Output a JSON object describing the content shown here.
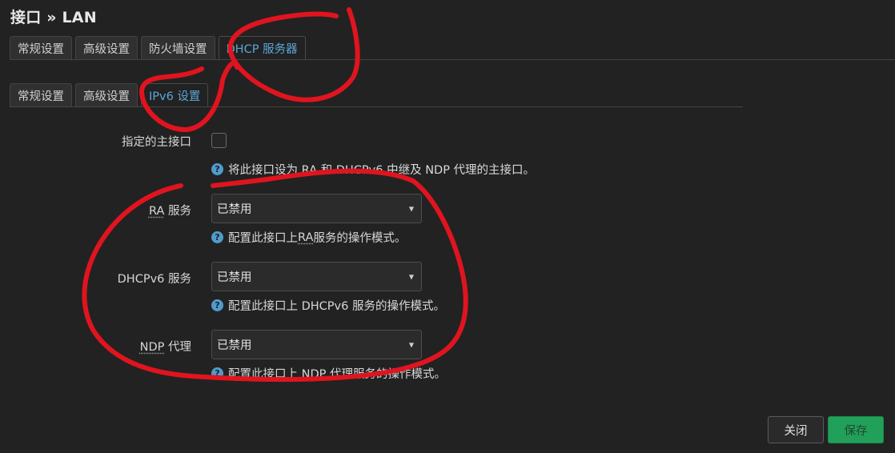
{
  "page": {
    "title": "接口 » LAN"
  },
  "primary_tabs": [
    {
      "label": "常规设置",
      "active": false
    },
    {
      "label": "高级设置",
      "active": false
    },
    {
      "label": "防火墙设置",
      "active": false
    },
    {
      "label": "DHCP 服务器",
      "active": true
    }
  ],
  "secondary_tabs": [
    {
      "label": "常规设置",
      "active": false
    },
    {
      "label": "高级设置",
      "active": false
    },
    {
      "label": "IPv6 设置",
      "active": true
    }
  ],
  "form": {
    "master": {
      "label": "指定的主接口",
      "checked": false,
      "help": "将此接口设为 RA 和 DHCPv6 中继及 NDP 代理的主接口。"
    },
    "ra": {
      "label_abbr": "RA",
      "label_rest": " 服务",
      "value": "已禁用",
      "help_pre": "配置此接口上 ",
      "help_abbr": "RA",
      "help_post": " 服务的操作模式。"
    },
    "dhcpv6": {
      "label": "DHCPv6 服务",
      "value": "已禁用",
      "help": "配置此接口上 DHCPv6 服务的操作模式。"
    },
    "ndp": {
      "label_abbr": "NDP",
      "label_rest": " 代理",
      "value": "已禁用",
      "help": "配置此接口上 NDP 代理服务的操作模式。"
    }
  },
  "buttons": {
    "close": "关闭",
    "save": "保存"
  },
  "colors": {
    "annotation": "#e0141f",
    "accent": "#5aa7d6",
    "save": "#21a05a"
  }
}
